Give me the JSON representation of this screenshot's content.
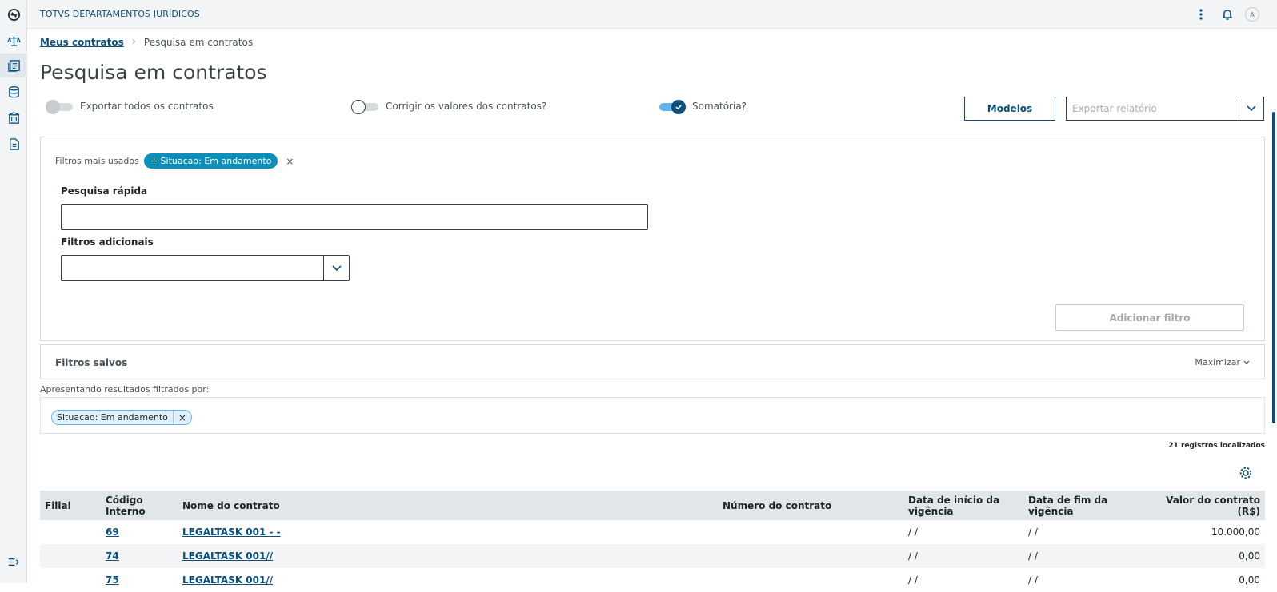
{
  "app": {
    "title": "TOTVS DEPARTAMENTOS JURÍDICOS",
    "avatar": "A"
  },
  "sidebar": {
    "items": [
      {
        "icon": "app-logo-icon"
      },
      {
        "icon": "scales-icon"
      },
      {
        "icon": "contracts-icon",
        "active": true
      },
      {
        "icon": "database-icon"
      },
      {
        "icon": "building-icon"
      },
      {
        "icon": "document-icon"
      }
    ],
    "collapse_icon": "collapse-menu-icon"
  },
  "breadcrumb": {
    "link": "Meus contratos",
    "separator": "›",
    "current": "Pesquisa em contratos"
  },
  "page": {
    "title": "Pesquisa em contratos"
  },
  "toggles": {
    "export_all": {
      "label": "Exportar todos os contratos",
      "on": false
    },
    "correct_values": {
      "label": "Corrigir os valores dos contratos?",
      "on": false
    },
    "sum": {
      "label": "Somatória?",
      "on": true
    }
  },
  "actions": {
    "models_label": "Modelos",
    "export_placeholder": "Exportar relatório"
  },
  "filters": {
    "most_used_label": "Filtros mais usados",
    "most_used_chip": "+ Situacao: Em andamento",
    "most_used_close": "×",
    "quick_search_label": "Pesquisa rápida",
    "quick_search_value": "",
    "additional_label": "Filtros adicionais",
    "add_filter_label": "Adicionar filtro"
  },
  "saved_filters": {
    "title": "Filtros salvos",
    "maximize_label": "Maximizar"
  },
  "results": {
    "label": "Apresentando resultados filtrados por:",
    "active_chip": "Situacao: Em andamento",
    "active_chip_close": "×",
    "count_label": "21 registros localizados"
  },
  "table": {
    "headers": [
      "Filial",
      "Código Interno",
      "Nome do contrato",
      "Número do contrato",
      "Data de início da vigência",
      "Data de fim da vigência",
      "Valor do contrato (R$)"
    ],
    "rows": [
      [
        "",
        "69",
        "LEGALTASK 001 - -",
        "",
        "/ /",
        "/ /",
        "10.000,00"
      ],
      [
        "",
        "74",
        "LEGALTASK 001//",
        "",
        "/ /",
        "/ /",
        "0,00"
      ],
      [
        "",
        "75",
        "LEGALTASK 001//",
        "",
        "/ /",
        "/ /",
        "0,00"
      ]
    ]
  }
}
